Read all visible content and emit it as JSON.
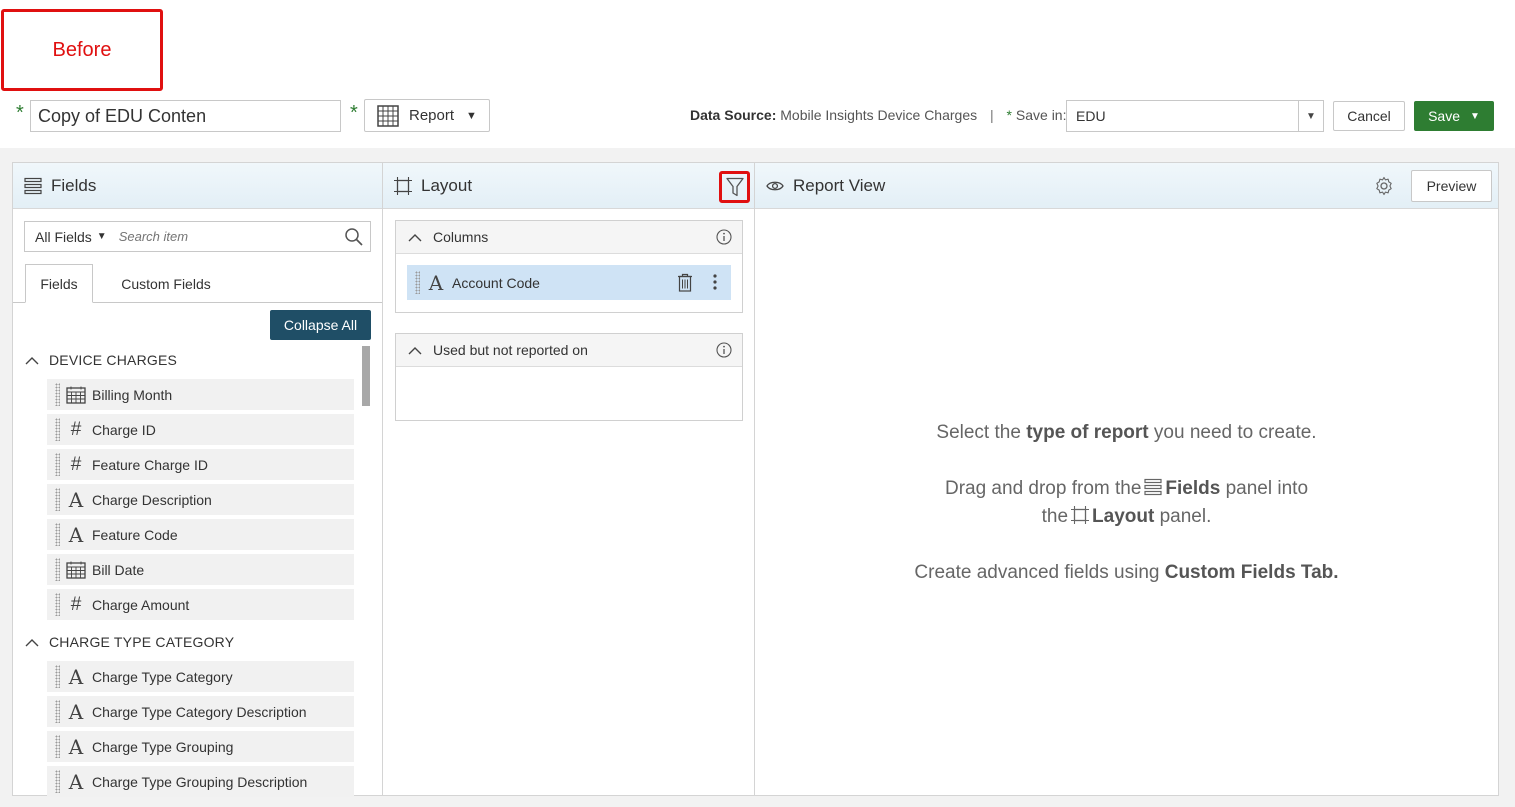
{
  "annotation": {
    "label": "Before"
  },
  "topbar": {
    "report_name_value": "Copy of EDU Conten",
    "report_type_label": "Report",
    "data_source_label": "Data Source:",
    "data_source_value": "Mobile Insights Device Charges",
    "separator": "|",
    "save_in_label": "Save in:",
    "save_in_value": "EDU",
    "cancel_label": "Cancel",
    "save_label": "Save"
  },
  "fields_panel": {
    "title": "Fields",
    "filter_label": "All Fields",
    "search_placeholder": "Search item",
    "tabs": [
      {
        "label": "Fields"
      },
      {
        "label": "Custom Fields"
      }
    ],
    "collapse_all_label": "Collapse All",
    "groups": [
      {
        "title": "DEVICE CHARGES",
        "items": [
          {
            "label": "Billing Month",
            "icon": "calendar-icon"
          },
          {
            "label": "Charge ID",
            "icon": "number-icon"
          },
          {
            "label": "Feature Charge ID",
            "icon": "number-icon"
          },
          {
            "label": "Charge Description",
            "icon": "text-icon"
          },
          {
            "label": "Feature Code",
            "icon": "text-icon"
          },
          {
            "label": "Bill Date",
            "icon": "calendar-icon"
          },
          {
            "label": "Charge Amount",
            "icon": "number-icon"
          }
        ]
      },
      {
        "title": "CHARGE TYPE CATEGORY",
        "items": [
          {
            "label": "Charge Type Category",
            "icon": "text-icon"
          },
          {
            "label": "Charge Type Category Description",
            "icon": "text-icon"
          },
          {
            "label": "Charge Type Grouping",
            "icon": "text-icon"
          },
          {
            "label": "Charge Type Grouping Description",
            "icon": "text-icon"
          }
        ]
      }
    ]
  },
  "layout_panel": {
    "title": "Layout",
    "columns_title": "Columns",
    "columns": [
      {
        "label": "Account Code",
        "icon": "text-icon"
      }
    ],
    "unused_title": "Used but not reported on"
  },
  "report_view": {
    "title": "Report View",
    "preview_label": "Preview",
    "msg1_a": "Select the ",
    "msg1_b": "type of report",
    "msg1_c": " you need to create.",
    "msg2_a": "Drag and drop from the",
    "msg2_b": "Fields",
    "msg2_c": " panel into",
    "msg3_a": "the",
    "msg3_b": "Layout",
    "msg3_c": " panel.",
    "msg4_a": "Create advanced fields using ",
    "msg4_b": "Custom Fields Tab."
  }
}
